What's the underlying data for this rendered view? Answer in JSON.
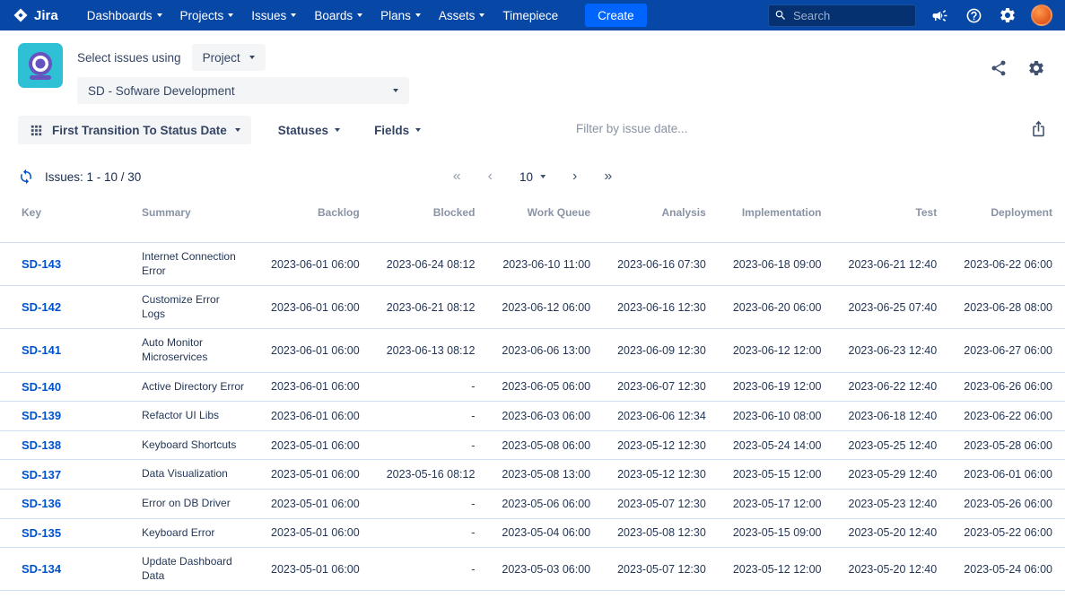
{
  "nav": {
    "logo_text": "Jira",
    "items": [
      "Dashboards",
      "Projects",
      "Issues",
      "Boards",
      "Plans",
      "Assets",
      "Timepiece"
    ],
    "create_label": "Create",
    "search_placeholder": "Search"
  },
  "header": {
    "select_label": "Select issues using",
    "mode_value": "Project",
    "project_value": "SD - Sofware Development"
  },
  "toolbar": {
    "report_label": "First Transition To Status Date",
    "statuses_label": "Statuses",
    "fields_label": "Fields",
    "filter_placeholder": "Filter by issue date..."
  },
  "pager": {
    "summary": "Issues: 1 - 10 / 30",
    "page_size": "10"
  },
  "icons": {
    "pagination_first": "«",
    "pagination_prev": "‹",
    "pagination_next": "›",
    "pagination_last": "»"
  },
  "colors": {
    "nav_bg": "#0747A6",
    "create_bg": "#0065FF",
    "link_blue": "#0052CC",
    "row_border": "#CFE0F2",
    "app_icon_teal": "#2EC1D5",
    "app_icon_purple": "#6554C0",
    "avatar_orange": "#E8632A"
  },
  "table": {
    "columns": [
      "Key",
      "Summary",
      "Backlog",
      "Blocked",
      "Work Queue",
      "Analysis",
      "Implementation",
      "Test",
      "Deployment"
    ],
    "rows": [
      {
        "key": "SD-143",
        "summary": "Internet Connection Error",
        "dates": [
          "2023-06-01 06:00",
          "2023-06-24 08:12",
          "2023-06-10 11:00",
          "2023-06-16 07:30",
          "2023-06-18 09:00",
          "2023-06-21 12:40",
          "2023-06-22 06:00"
        ]
      },
      {
        "key": "SD-142",
        "summary": "Customize Error Logs",
        "dates": [
          "2023-06-01 06:00",
          "2023-06-21 08:12",
          "2023-06-12 06:00",
          "2023-06-16 12:30",
          "2023-06-20 06:00",
          "2023-06-25 07:40",
          "2023-06-28 08:00"
        ]
      },
      {
        "key": "SD-141",
        "summary": "Auto Monitor Microservices",
        "dates": [
          "2023-06-01 06:00",
          "2023-06-13 08:12",
          "2023-06-06 13:00",
          "2023-06-09 12:30",
          "2023-06-12 12:00",
          "2023-06-23 12:40",
          "2023-06-27 06:00"
        ]
      },
      {
        "key": "SD-140",
        "summary": "Active Directory Error",
        "dates": [
          "2023-06-01 06:00",
          "-",
          "2023-06-05 06:00",
          "2023-06-07 12:30",
          "2023-06-19 12:00",
          "2023-06-22 12:40",
          "2023-06-26 06:00"
        ]
      },
      {
        "key": "SD-139",
        "summary": "Refactor UI Libs",
        "dates": [
          "2023-06-01 06:00",
          "-",
          "2023-06-03 06:00",
          "2023-06-06 12:34",
          "2023-06-10 08:00",
          "2023-06-18 12:40",
          "2023-06-22 06:00"
        ]
      },
      {
        "key": "SD-138",
        "summary": "Keyboard Shortcuts",
        "dates": [
          "2023-05-01 06:00",
          "-",
          "2023-05-08 06:00",
          "2023-05-12 12:30",
          "2023-05-24 14:00",
          "2023-05-25 12:40",
          "2023-05-28 06:00"
        ]
      },
      {
        "key": "SD-137",
        "summary": "Data Visualization",
        "dates": [
          "2023-05-01 06:00",
          "2023-05-16 08:12",
          "2023-05-08 13:00",
          "2023-05-12 12:30",
          "2023-05-15 12:00",
          "2023-05-29 12:40",
          "2023-06-01 06:00"
        ]
      },
      {
        "key": "SD-136",
        "summary": "Error on DB Driver",
        "dates": [
          "2023-05-01 06:00",
          "-",
          "2023-05-06 06:00",
          "2023-05-07 12:30",
          "2023-05-17 12:00",
          "2023-05-23 12:40",
          "2023-05-26 06:00"
        ]
      },
      {
        "key": "SD-135",
        "summary": "Keyboard Error",
        "dates": [
          "2023-05-01 06:00",
          "-",
          "2023-05-04 06:00",
          "2023-05-08 12:30",
          "2023-05-15 09:00",
          "2023-05-20 12:40",
          "2023-05-22 06:00"
        ]
      },
      {
        "key": "SD-134",
        "summary": "Update Dashboard Data",
        "dates": [
          "2023-05-01 06:00",
          "-",
          "2023-05-03 06:00",
          "2023-05-07 12:30",
          "2023-05-12 12:00",
          "2023-05-20 12:40",
          "2023-05-24 06:00"
        ]
      }
    ]
  }
}
